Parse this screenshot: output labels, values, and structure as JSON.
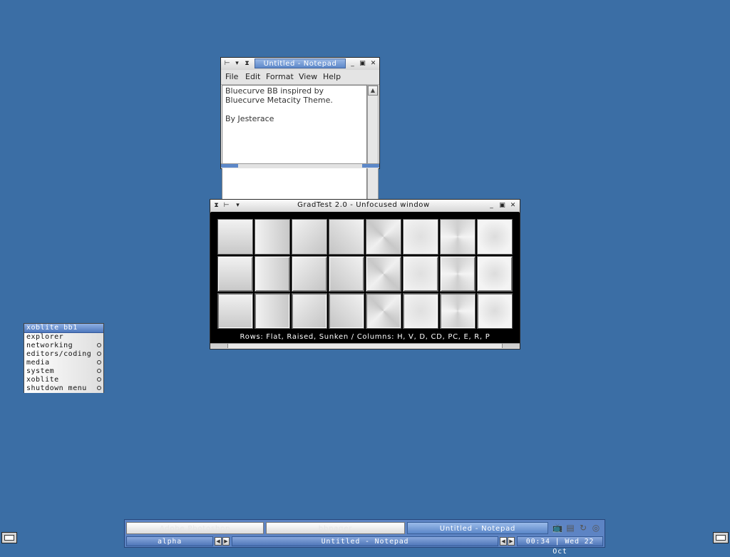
{
  "notepad": {
    "title": "Untitled - Notepad",
    "menus": [
      "File",
      "Edit",
      "Format",
      "View",
      "Help"
    ],
    "lines": [
      "Bluecurve BB inspired by",
      "Bluecurve Metacity Theme.",
      "",
      "By Jesterace"
    ]
  },
  "gradtest": {
    "title": "GradTest 2.0 - Unfocused window",
    "caption": "Rows: Flat, Raised, Sunken / Columns: H, V, D, CD, PC, E, R, P"
  },
  "menu": {
    "title": "xoblite bb1",
    "items": [
      "explorer",
      "networking",
      "editors/coding",
      "media",
      "system",
      "xoblite",
      "shutdown menu"
    ]
  },
  "taskbar": {
    "tasks": [
      "Adobe Photoshop",
      "bbpager",
      "Untitled - Notepad"
    ],
    "workspace": "alpha",
    "window_label": "Untitled - Notepad",
    "clock": "00:34 | Wed 22 Oct"
  },
  "icons": {
    "titlebar": [
      "menu-icon",
      "stick-icon",
      "shade-icon",
      "minimize-icon",
      "maximize-icon",
      "close-icon"
    ],
    "tray": [
      "tv-icon",
      "disk-icon",
      "refresh-icon",
      "cd-icon"
    ]
  },
  "colors": {
    "desktop": "#3b6ea5",
    "focused_title": "#5d88c9",
    "toolbar": "#5d84c4"
  }
}
